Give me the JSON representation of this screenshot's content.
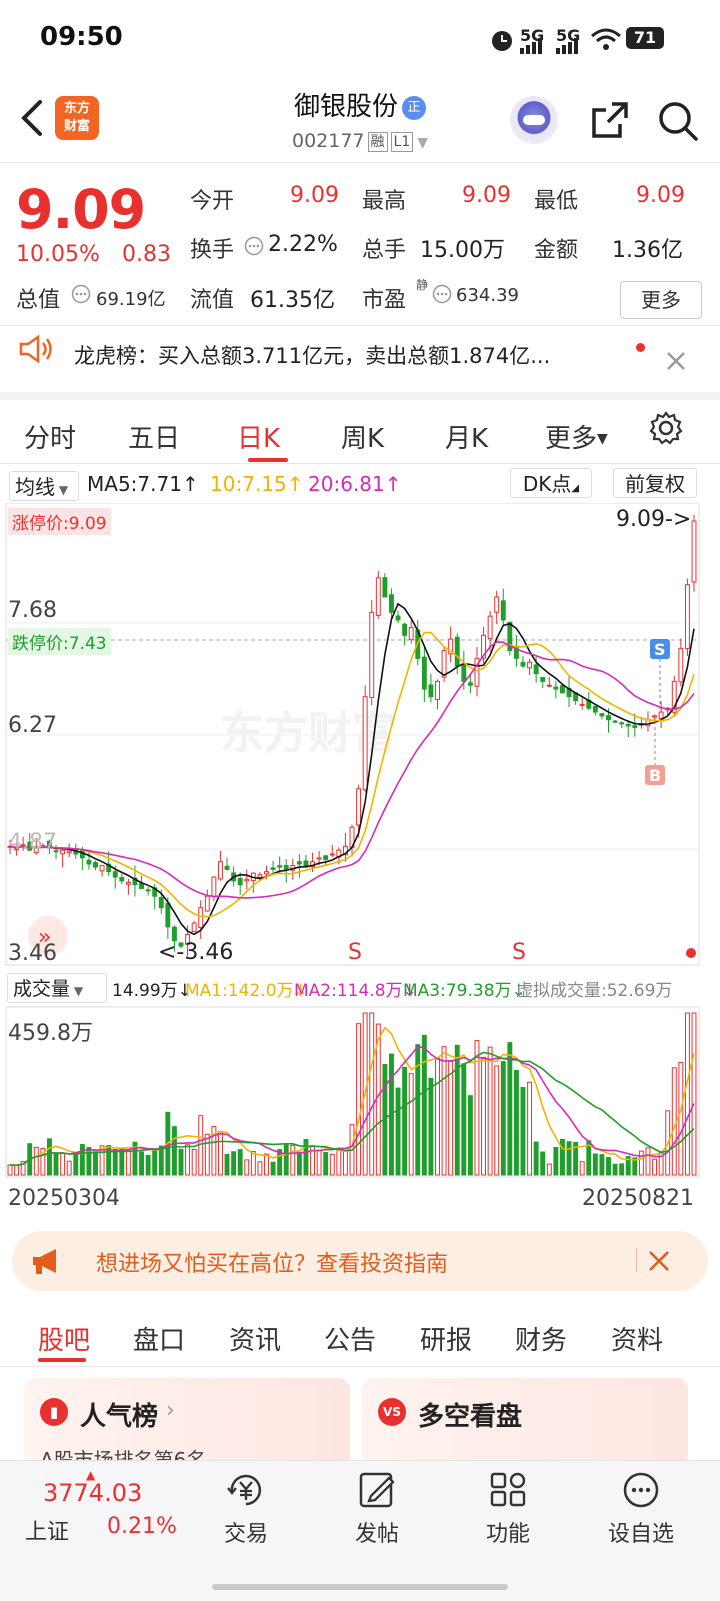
{
  "status_bar": {
    "time": "09:50",
    "net1": "5G",
    "net2": "5G",
    "battery": "71"
  },
  "header": {
    "name": "御银股份",
    "badge": "正",
    "code": "002177",
    "tag_margin": "融",
    "tag_level": "L1",
    "logo_line1": "东方",
    "logo_line2": "财富"
  },
  "quote": {
    "price": "9.09",
    "change_pct": "10.05%",
    "change_abs": "0.83",
    "open_label": "今开",
    "open": "9.09",
    "high_label": "最高",
    "high": "9.09",
    "low_label": "最低",
    "low": "9.09",
    "turnover_label": "换手",
    "turnover": "2.22%",
    "volume_label": "总手",
    "volume": "15.00万",
    "amount_label": "金额",
    "amount": "1.36亿",
    "mktcap_label": "总值",
    "mktcap": "69.19亿",
    "float_label": "流值",
    "float_cap": "61.35亿",
    "pe_label": "市盈",
    "pe_sup": "静",
    "pe": "634.39",
    "more_label": "更多"
  },
  "notice": {
    "text": "龙虎榜：买入总额3.711亿元，卖出总额1.874亿..."
  },
  "tabs": {
    "t1": "分时",
    "t2": "五日",
    "t3": "日K",
    "t4": "周K",
    "t5": "月K",
    "t6": "更多"
  },
  "ma_bar": {
    "selector": "均线",
    "ma5": "MA5:7.71",
    "ma10": "10:7.15",
    "ma20": "20:6.81",
    "dk": "DK点",
    "adjust": "前复权"
  },
  "kline": {
    "y_top": "9.09",
    "y_mid": "7.68",
    "y_low": "6.27",
    "y_4": "4.87",
    "y_bottom": "3.46",
    "limit_up": "涨停价:9.09",
    "limit_down": "跌停价:7.43",
    "max_marker": "9.09->",
    "min_marker": "<-3.46",
    "mark_s": "S",
    "mark_b": "B",
    "watermark": "东方财富"
  },
  "volume_bar": {
    "selector": "成交量",
    "vol": "14.99万",
    "ma1": "MA1:142.0万",
    "ma2": "MA2:114.8万",
    "ma3": "MA3:79.38万",
    "virtual": "虚拟成交量:52.69万",
    "y_top": "459.8万"
  },
  "dates": {
    "start": "20250304",
    "end": "20250821"
  },
  "banner": {
    "text": "想进场又怕买在高位？查看投资指南"
  },
  "section_tabs": {
    "s1": "股吧",
    "s2": "盘口",
    "s3": "资讯",
    "s4": "公告",
    "s5": "研报",
    "s6": "财务",
    "s7": "资料"
  },
  "cards": {
    "pop_title": "人气榜",
    "pop_sub": "A股市场排名第6名",
    "vs_title": "多空看盘"
  },
  "bottom_nav": {
    "index_value": "3774.03",
    "index_name": "上证",
    "index_pct": "0.21%",
    "n1": "交易",
    "n2": "发帖",
    "n3": "功能",
    "n4": "设自选"
  },
  "chart_data": {
    "type": "candlestick",
    "x_range": [
      "20250304",
      "20250821"
    ],
    "ylim": [
      3.46,
      9.09
    ],
    "y_ticks": [
      9.09,
      7.68,
      6.27,
      4.87,
      3.46
    ],
    "close": [
      4.85,
      4.82,
      4.87,
      4.8,
      4.84,
      4.86,
      4.83,
      4.78,
      4.8,
      4.79,
      4.75,
      4.7,
      4.62,
      4.58,
      4.6,
      4.52,
      4.45,
      4.4,
      4.38,
      4.35,
      4.3,
      4.28,
      4.2,
      4.05,
      3.8,
      3.62,
      3.55,
      3.7,
      3.85,
      4.05,
      4.2,
      4.45,
      4.65,
      4.55,
      4.4,
      4.35,
      4.42,
      4.5,
      4.48,
      4.52,
      4.55,
      4.58,
      4.55,
      4.6,
      4.62,
      4.58,
      4.65,
      4.7,
      4.68,
      4.75,
      4.8,
      4.85,
      5.1,
      5.6,
      6.8,
      7.9,
      8.35,
      8.1,
      7.9,
      7.8,
      7.6,
      7.7,
      7.3,
      6.9,
      6.8,
      7.0,
      7.4,
      7.55,
      7.2,
      7.0,
      6.95,
      7.3,
      7.6,
      7.85,
      8.1,
      7.8,
      7.4,
      7.3,
      7.2,
      7.25,
      7.1,
      7.0,
      6.95,
      6.9,
      6.85,
      6.8,
      6.75,
      6.7,
      6.65,
      6.6,
      6.55,
      6.5,
      6.48,
      6.45,
      6.42,
      6.4,
      6.45,
      6.5,
      6.55,
      6.6,
      6.65,
      7.0,
      7.43,
      8.26,
      9.09
    ],
    "ma5_last": 7.71,
    "ma10_last": 7.15,
    "ma20_last": 6.81,
    "volume_ylim": [
      0,
      459.8
    ],
    "volume_unit": "万"
  }
}
